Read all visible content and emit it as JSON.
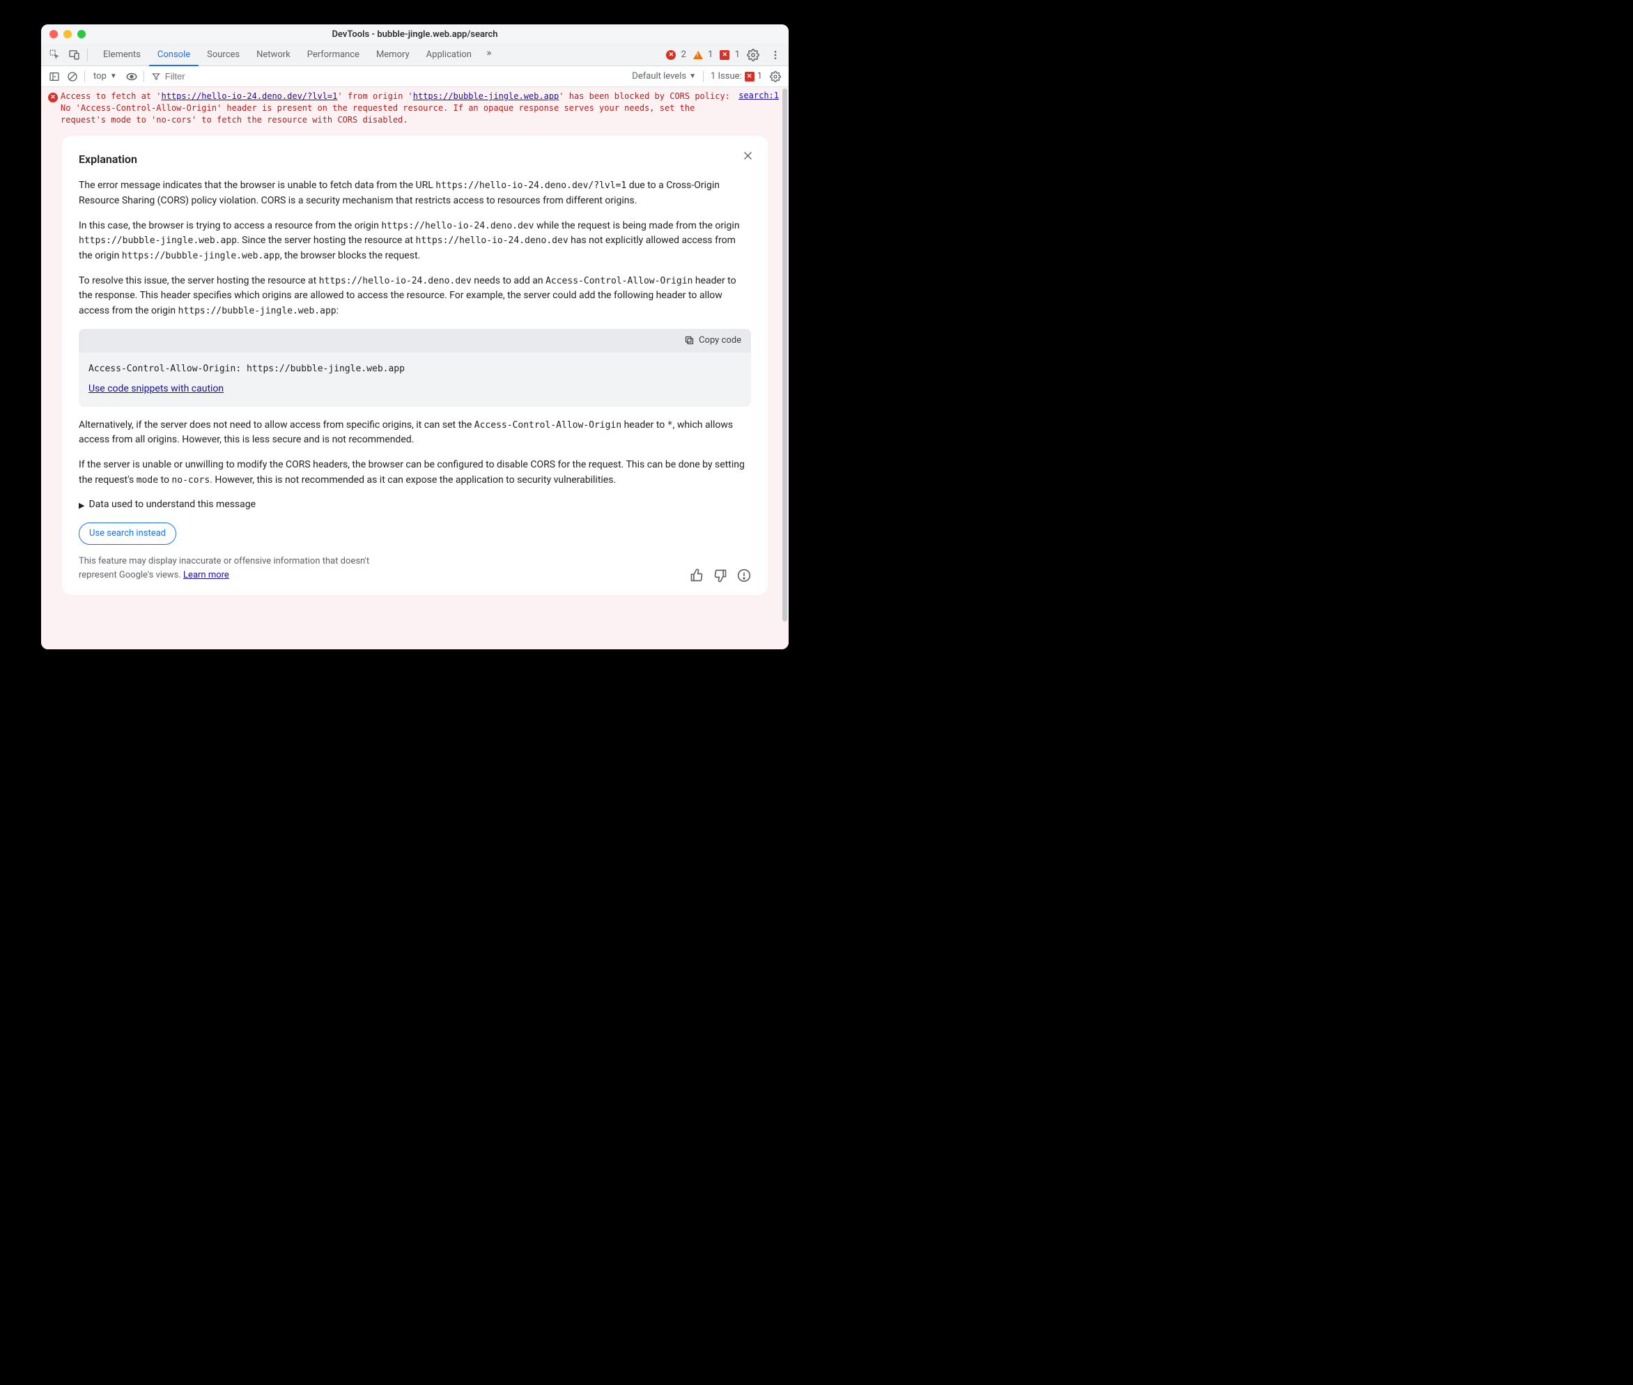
{
  "window": {
    "title": "DevTools - bubble-jingle.web.app/search"
  },
  "tabs": {
    "items": [
      "Elements",
      "Console",
      "Sources",
      "Network",
      "Performance",
      "Memory",
      "Application"
    ],
    "active": "Console"
  },
  "badges": {
    "errors": "2",
    "warnings": "1",
    "ext_errors": "1"
  },
  "toolbar": {
    "context": "top",
    "filter_placeholder": "Filter",
    "levels_label": "Default levels",
    "issues_label": "1 Issue:",
    "issues_count": "1"
  },
  "error": {
    "pre1": "Access to fetch at '",
    "url1": "https://hello-io-24.deno.dev/?lvl=1",
    "mid1": "' from origin '",
    "url2": "https://bubble-jingle.web.app",
    "post": "' has been blocked by CORS policy: No 'Access-Control-Allow-Origin' header is present on the requested resource. If an opaque response serves your needs, set the request's mode to 'no-cors' to fetch the resource with CORS disabled.",
    "source": "search:1"
  },
  "explain": {
    "title": "Explanation",
    "p1a": "The error message indicates that the browser is unable to fetch data from the URL ",
    "p1code": "https://hello-io-24.deno.dev/?lvl=1",
    "p1b": " due to a Cross-Origin Resource Sharing (CORS) policy violation. CORS is a security mechanism that restricts access to resources from different origins.",
    "p2a": "In this case, the browser is trying to access a resource from the origin ",
    "p2code1": "https://hello-io-24.deno.dev",
    "p2b": " while the request is being made from the origin ",
    "p2code2": "https://bubble-jingle.web.app",
    "p2c": ". Since the server hosting the resource at ",
    "p2code3": "https://hello-io-24.deno.dev",
    "p2d": " has not explicitly allowed access from the origin ",
    "p2code4": "https://bubble-jingle.web.app",
    "p2e": ", the browser blocks the request.",
    "p3a": "To resolve this issue, the server hosting the resource at ",
    "p3code1": "https://hello-io-24.deno.dev",
    "p3b": " needs to add an ",
    "p3code2": "Access-Control-Allow-Origin",
    "p3c": " header to the response. This header specifies which origins are allowed to access the resource. For example, the server could add the following header to allow access from the origin ",
    "p3code3": "https://bubble-jingle.web.app",
    "p3d": ":",
    "copy_label": "Copy code",
    "code": "Access-Control-Allow-Origin: https://bubble-jingle.web.app",
    "caution": "Use code snippets with caution",
    "p4a": "Alternatively, if the server does not need to allow access from specific origins, it can set the ",
    "p4code1": "Access-Control-Allow-Origin",
    "p4b": " header to ",
    "p4code2": "*",
    "p4c": ", which allows access from all origins. However, this is less secure and is not recommended.",
    "p5a": "If the server is unable or unwilling to modify the CORS headers, the browser can be configured to disable CORS for the request. This can be done by setting the request's ",
    "p5code1": "mode",
    "p5b": " to ",
    "p5code2": "no-cors",
    "p5c": ". However, this is not recommended as it can expose the application to security vulnerabilities.",
    "disclosure": "Data used to understand this message",
    "use_search": "Use search instead",
    "disclaimer": "This feature may display inaccurate or offensive information that doesn't represent Google's views. ",
    "learn_more": "Learn more"
  }
}
